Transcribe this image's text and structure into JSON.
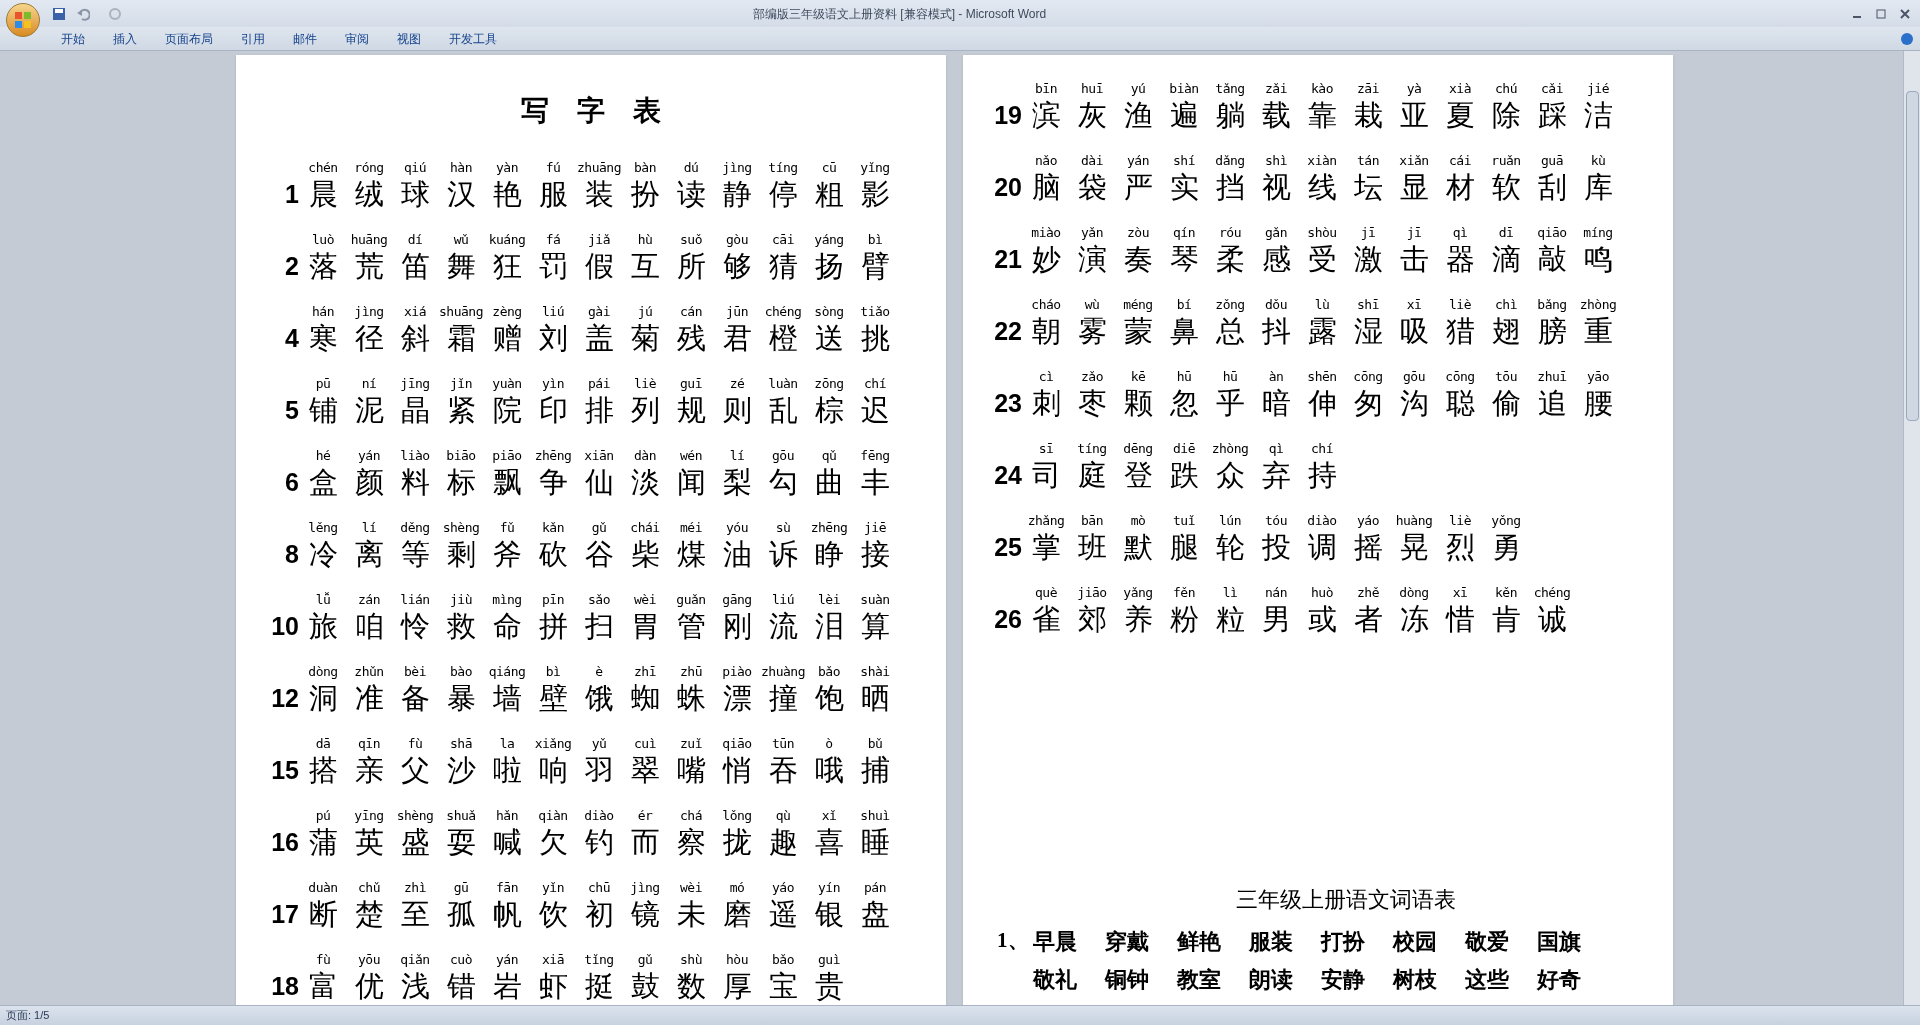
{
  "window": {
    "title": "部编版三年级语文上册资料 [兼容模式] - Microsoft Word"
  },
  "ribbon_tabs": [
    "开始",
    "插入",
    "页面布局",
    "引用",
    "邮件",
    "审阅",
    "视图",
    "开发工具"
  ],
  "left_page": {
    "title": "写　字　表",
    "rows": [
      {
        "number": "1",
        "pinyin": [
          "chén",
          "róng",
          "qiú",
          "hàn",
          "yàn",
          "fú",
          "zhuāng",
          "bàn",
          "dú",
          "jìng",
          "tíng",
          "cū",
          "yǐng"
        ],
        "chars": [
          "晨",
          "绒",
          "球",
          "汉",
          "艳",
          "服",
          "装",
          "扮",
          "读",
          "静",
          "停",
          "粗",
          "影"
        ]
      },
      {
        "number": "2",
        "pinyin": [
          "luò",
          "huāng",
          "dí",
          "wǔ",
          "kuáng",
          "fá",
          "jiǎ",
          "hù",
          "suǒ",
          "gòu",
          "cāi",
          "yáng",
          "bì"
        ],
        "chars": [
          "落",
          "荒",
          "笛",
          "舞",
          "狂",
          "罚",
          "假",
          "互",
          "所",
          "够",
          "猜",
          "扬",
          "臂"
        ]
      },
      {
        "number": "4",
        "pinyin": [
          "hán",
          "jìng",
          "xiá",
          "shuāng",
          "zèng",
          "liú",
          "gài",
          "jú",
          "cán",
          "jūn",
          "chéng",
          "sòng",
          "tiǎo"
        ],
        "chars": [
          "寒",
          "径",
          "斜",
          "霜",
          "赠",
          "刘",
          "盖",
          "菊",
          "残",
          "君",
          "橙",
          "送",
          "挑"
        ]
      },
      {
        "number": "5",
        "pinyin": [
          "pū",
          "ní",
          "jīng",
          "jǐn",
          "yuàn",
          "yìn",
          "pái",
          "liè",
          "guī",
          "zé",
          "luàn",
          "zōng",
          "chí"
        ],
        "chars": [
          "铺",
          "泥",
          "晶",
          "紧",
          "院",
          "印",
          "排",
          "列",
          "规",
          "则",
          "乱",
          "棕",
          "迟"
        ]
      },
      {
        "number": "6",
        "pinyin": [
          "hé",
          "yán",
          "liào",
          "biāo",
          "piāo",
          "zhēng",
          "xiān",
          "dàn",
          "wén",
          "lí",
          "gōu",
          "qǔ",
          "fēng"
        ],
        "chars": [
          "盒",
          "颜",
          "料",
          "标",
          "飘",
          "争",
          "仙",
          "淡",
          "闻",
          "梨",
          "勾",
          "曲",
          "丰"
        ]
      },
      {
        "number": "8",
        "pinyin": [
          "lěng",
          "lí",
          "děng",
          "shèng",
          "fǔ",
          "kǎn",
          "gǔ",
          "chái",
          "méi",
          "yóu",
          "sù",
          "zhēng",
          "jiē"
        ],
        "chars": [
          "冷",
          "离",
          "等",
          "剩",
          "斧",
          "砍",
          "谷",
          "柴",
          "煤",
          "油",
          "诉",
          "睁",
          "接"
        ]
      },
      {
        "number": "10",
        "pinyin": [
          "lǚ",
          "zán",
          "lián",
          "jiù",
          "mìng",
          "pīn",
          "sǎo",
          "wèi",
          "guǎn",
          "gāng",
          "liú",
          "lèi",
          "suàn"
        ],
        "chars": [
          "旅",
          "咱",
          "怜",
          "救",
          "命",
          "拼",
          "扫",
          "胃",
          "管",
          "刚",
          "流",
          "泪",
          "算"
        ]
      },
      {
        "number": "12",
        "pinyin": [
          "dòng",
          "zhǔn",
          "bèi",
          "bào",
          "qiáng",
          "bì",
          "è",
          "zhī",
          "zhū",
          "piào",
          "zhuàng",
          "bǎo",
          "shài"
        ],
        "chars": [
          "洞",
          "准",
          "备",
          "暴",
          "墙",
          "壁",
          "饿",
          "蜘",
          "蛛",
          "漂",
          "撞",
          "饱",
          "晒"
        ]
      },
      {
        "number": "15",
        "pinyin": [
          "dā",
          "qīn",
          "fù",
          "shā",
          "la",
          "xiǎng",
          "yǔ",
          "cuì",
          "zuǐ",
          "qiāo",
          "tūn",
          "ò",
          "bǔ"
        ],
        "chars": [
          "搭",
          "亲",
          "父",
          "沙",
          "啦",
          "响",
          "羽",
          "翠",
          "嘴",
          "悄",
          "吞",
          "哦",
          "捕"
        ]
      },
      {
        "number": "16",
        "pinyin": [
          "pú",
          "yīng",
          "shèng",
          "shuǎ",
          "hǎn",
          "qiàn",
          "diào",
          "ér",
          "chá",
          "lǒng",
          "qù",
          "xǐ",
          "shuì"
        ],
        "chars": [
          "蒲",
          "英",
          "盛",
          "耍",
          "喊",
          "欠",
          "钓",
          "而",
          "察",
          "拢",
          "趣",
          "喜",
          "睡"
        ]
      },
      {
        "number": "17",
        "pinyin": [
          "duàn",
          "chǔ",
          "zhì",
          "gū",
          "fān",
          "yǐn",
          "chū",
          "jìng",
          "wèi",
          "mó",
          "yáo",
          "yín",
          "pán"
        ],
        "chars": [
          "断",
          "楚",
          "至",
          "孤",
          "帆",
          "饮",
          "初",
          "镜",
          "未",
          "磨",
          "遥",
          "银",
          "盘"
        ]
      },
      {
        "number": "18",
        "pinyin": [
          "fù",
          "yōu",
          "qiǎn",
          "cuò",
          "yán",
          "xiā",
          "tǐng",
          "gǔ",
          "shù",
          "hòu",
          "bǎo",
          "guì"
        ],
        "chars": [
          "富",
          "优",
          "浅",
          "错",
          "岩",
          "虾",
          "挺",
          "鼓",
          "数",
          "厚",
          "宝",
          "贵"
        ]
      }
    ]
  },
  "right_page": {
    "rows": [
      {
        "number": "19",
        "pinyin": [
          "bīn",
          "huī",
          "yú",
          "biàn",
          "tǎng",
          "zǎi",
          "kào",
          "zāi",
          "yà",
          "xià",
          "chú",
          "cǎi",
          "jié"
        ],
        "chars": [
          "滨",
          "灰",
          "渔",
          "遍",
          "躺",
          "载",
          "靠",
          "栽",
          "亚",
          "夏",
          "除",
          "踩",
          "洁"
        ]
      },
      {
        "number": "20",
        "pinyin": [
          "nǎo",
          "dài",
          "yán",
          "shí",
          "dǎng",
          "shì",
          "xiàn",
          "tán",
          "xiǎn",
          "cái",
          "ruǎn",
          "guā",
          "kù"
        ],
        "chars": [
          "脑",
          "袋",
          "严",
          "实",
          "挡",
          "视",
          "线",
          "坛",
          "显",
          "材",
          "软",
          "刮",
          "库"
        ]
      },
      {
        "number": "21",
        "pinyin": [
          "miào",
          "yǎn",
          "zòu",
          "qín",
          "róu",
          "gǎn",
          "shòu",
          "jī",
          "jī",
          "qì",
          "dī",
          "qiāo",
          "míng"
        ],
        "chars": [
          "妙",
          "演",
          "奏",
          "琴",
          "柔",
          "感",
          "受",
          "激",
          "击",
          "器",
          "滴",
          "敲",
          "鸣"
        ]
      },
      {
        "number": "22",
        "pinyin": [
          "cháo",
          "wù",
          "méng",
          "bí",
          "zǒng",
          "dǒu",
          "lù",
          "shī",
          "xī",
          "liè",
          "chì",
          "bǎng",
          "zhòng"
        ],
        "chars": [
          "朝",
          "雾",
          "蒙",
          "鼻",
          "总",
          "抖",
          "露",
          "湿",
          "吸",
          "猎",
          "翅",
          "膀",
          "重"
        ]
      },
      {
        "number": "23",
        "pinyin": [
          "cì",
          "zǎo",
          "kē",
          "hū",
          "hū",
          "àn",
          "shēn",
          "cōng",
          "gōu",
          "cōng",
          "tōu",
          "zhuī",
          "yāo"
        ],
        "chars": [
          "刺",
          "枣",
          "颗",
          "忽",
          "乎",
          "暗",
          "伸",
          "匆",
          "沟",
          "聪",
          "偷",
          "追",
          "腰"
        ]
      },
      {
        "number": "24",
        "pinyin": [
          "sī",
          "tíng",
          "dēng",
          "diē",
          "zhòng",
          "qì",
          "chí"
        ],
        "chars": [
          "司",
          "庭",
          "登",
          "跌",
          "众",
          "弃",
          "持"
        ]
      },
      {
        "number": "25",
        "pinyin": [
          "zhǎng",
          "bān",
          "mò",
          "tuǐ",
          "lún",
          "tóu",
          "diào",
          "yáo",
          "huàng",
          "liè",
          "yǒng"
        ],
        "chars": [
          "掌",
          "班",
          "默",
          "腿",
          "轮",
          "投",
          "调",
          "摇",
          "晃",
          "烈",
          "勇"
        ]
      },
      {
        "number": "26",
        "pinyin": [
          "què",
          "jiāo",
          "yǎng",
          "fěn",
          "lì",
          "nán",
          "huò",
          "zhě",
          "dòng",
          "xī",
          "kěn",
          "chéng"
        ],
        "chars": [
          "雀",
          "郊",
          "养",
          "粉",
          "粒",
          "男",
          "或",
          "者",
          "冻",
          "惜",
          "肯",
          "诚"
        ]
      }
    ],
    "word_list_title": "三年级上册语文词语表",
    "word_rows": [
      {
        "label": "1、",
        "words": [
          "早晨",
          "穿戴",
          "鲜艳",
          "服装",
          "打扮",
          "校园",
          "敬爱",
          "国旗"
        ]
      },
      {
        "words": [
          "敬礼",
          "铜钟",
          "教室",
          "朗读",
          "安静",
          "树枝",
          "这些",
          "好奇"
        ]
      }
    ]
  },
  "status_bar": {
    "page": "页面: 1/5"
  }
}
